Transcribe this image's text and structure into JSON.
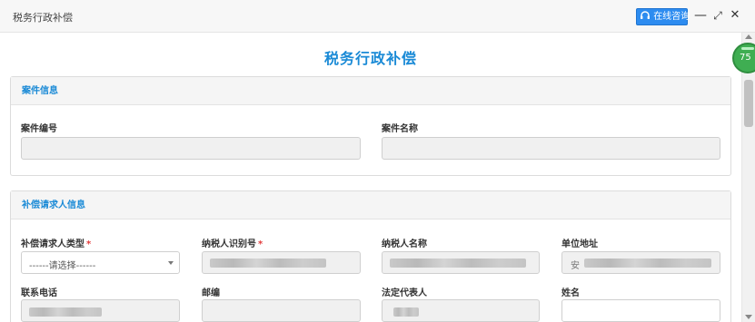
{
  "window": {
    "title": "税务行政补偿",
    "consult_button": "在线咨询",
    "minimize_glyph": "—",
    "maximize_glyph": "⤢",
    "close_glyph": "✕"
  },
  "badge_text": "75",
  "page_title": "税务行政补偿",
  "sections": {
    "case_info": {
      "heading": "案件信息",
      "fields": {
        "case_number": "案件编号",
        "case_name": "案件名称"
      }
    },
    "claimant_info": {
      "heading": "补偿请求人信息",
      "fields": {
        "claimant_type": "补偿请求人类型",
        "claimant_type_required": "*",
        "claimant_type_value": "------请选择------",
        "taxpayer_id": "纳税人识别号",
        "taxpayer_id_required": "*",
        "taxpayer_name": "纳税人名称",
        "unit_address": "单位地址",
        "unit_address_prefix": "安",
        "phone": "联系电话",
        "postcode": "邮编",
        "legal_rep": "法定代表人",
        "person_name": "姓名"
      }
    }
  },
  "colors": {
    "accent": "#1a8ad6",
    "button_bg": "#2d8cf0",
    "required": "#e23b3b",
    "badge": "#3fae52"
  },
  "icons": {
    "consult": "headset-icon",
    "minimize": "minimize-icon",
    "maximize": "maximize-icon",
    "close": "close-icon",
    "dropdown": "chevron-down-icon"
  }
}
